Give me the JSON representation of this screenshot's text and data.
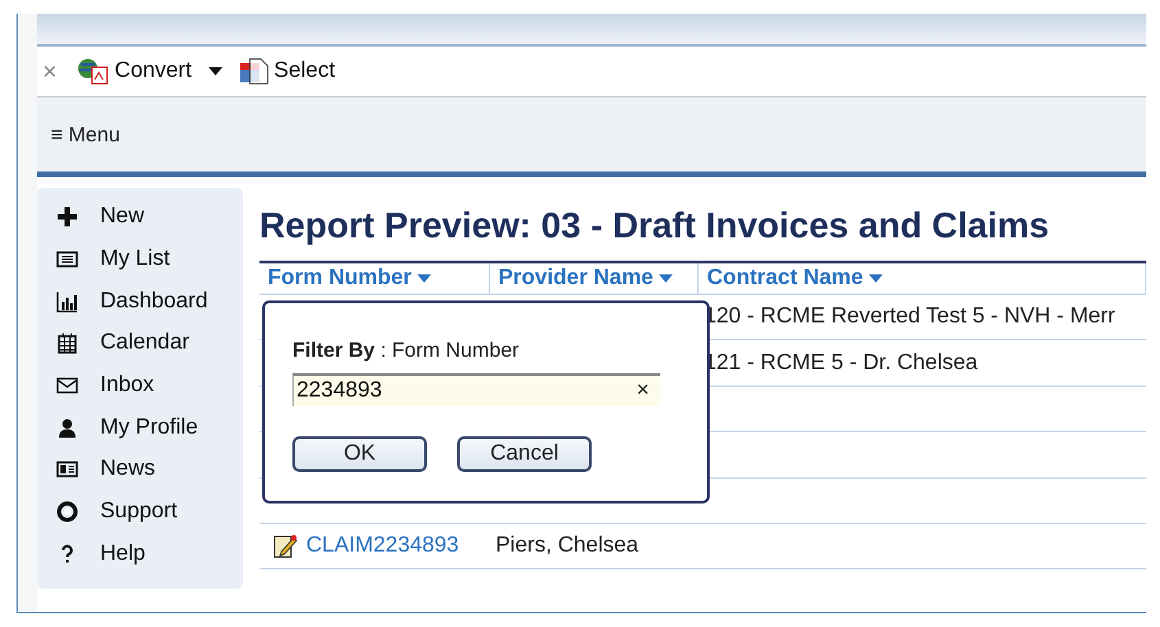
{
  "toolbar": {
    "close": "×",
    "convert": "Convert",
    "select": "Select"
  },
  "menu_button": "≡ Menu",
  "sidebar": {
    "items": [
      "New",
      "My List",
      "Dashboard",
      "Calendar",
      "Inbox",
      "My Profile",
      "News",
      "Support",
      "Help"
    ]
  },
  "title": "Report Preview: 03 - Draft Invoices and Claims",
  "table": {
    "columns": [
      "Form Number",
      "Provider Name",
      "Contract Name"
    ],
    "rows": [
      {
        "form": "",
        "provider": "",
        "contract": "120 - RCME Reverted Test 5 - NVH - Merr"
      },
      {
        "form": "",
        "provider": "",
        "contract": "121 - RCME 5 - Dr. Chelsea"
      },
      {
        "form": "",
        "provider": "",
        "contract": ""
      },
      {
        "form": "",
        "provider": "",
        "contract": ""
      },
      {
        "form": "",
        "provider": "",
        "contract": ""
      },
      {
        "form": "CLAIM2234893",
        "provider": "Piers, Chelsea",
        "contract": ""
      }
    ]
  },
  "filter_dialog": {
    "label_bold": "Filter By",
    "label_rest": ": Form Number",
    "value": "2234893",
    "clear": "×",
    "buttons": [
      "OK",
      "Cancel"
    ]
  }
}
